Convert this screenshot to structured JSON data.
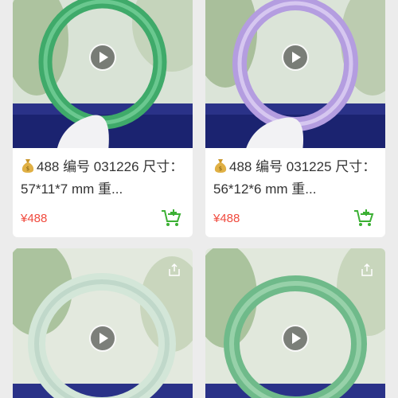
{
  "products": [
    {
      "title": "488 编号 031226 尺寸： 57*11*7 mm 重...",
      "price": "¥488",
      "has_share": false
    },
    {
      "title": "488 编号 031225 尺寸： 56*12*6 mm 重...",
      "price": "¥488",
      "has_share": false
    },
    {
      "title": "",
      "price": "",
      "has_share": true
    },
    {
      "title": "",
      "price": "",
      "has_share": true
    }
  ],
  "icons": {
    "play": "play-icon",
    "share": "share-icon",
    "cart": "add-to-cart-icon",
    "money": "money-bag-icon"
  },
  "colors": {
    "price": "#f04a3e",
    "cart": "#3cb034",
    "page_bg": "#ececec"
  }
}
